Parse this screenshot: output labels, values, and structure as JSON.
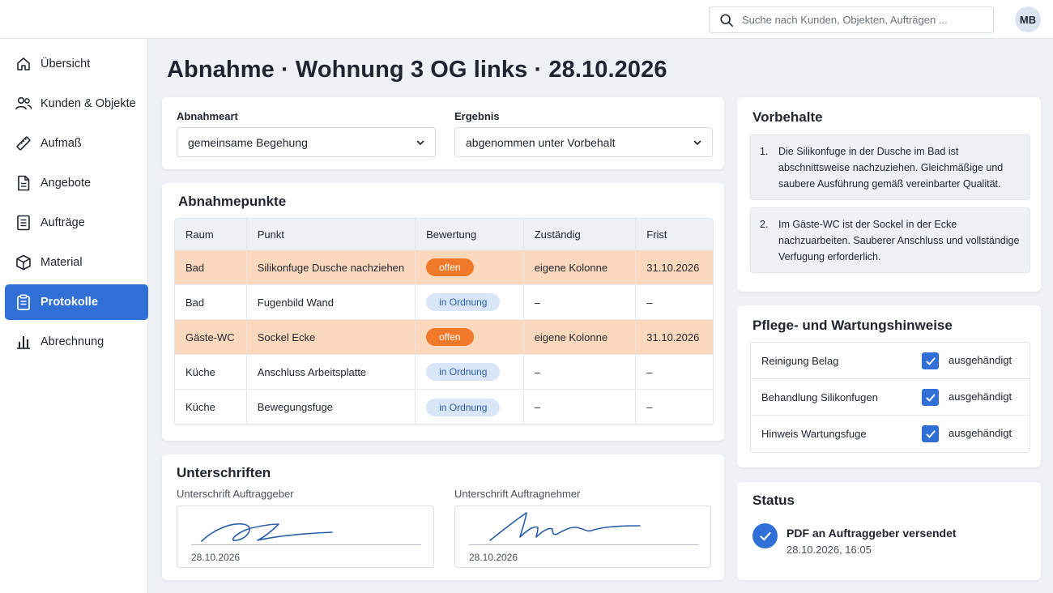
{
  "header": {
    "search_placeholder": "Suche nach Kunden, Objekten, Aufträgen ...",
    "avatar_initials": "MB"
  },
  "sidebar": {
    "items": [
      {
        "label": "Übersicht",
        "icon": "home-icon"
      },
      {
        "label": "Kunden & Objekte",
        "icon": "users-icon"
      },
      {
        "label": "Aufmaß",
        "icon": "ruler-icon"
      },
      {
        "label": "Angebote",
        "icon": "document-icon"
      },
      {
        "label": "Aufträge",
        "icon": "list-icon"
      },
      {
        "label": "Material",
        "icon": "box-icon"
      },
      {
        "label": "Protokolle",
        "icon": "clipboard-icon",
        "active": true
      },
      {
        "label": "Abrechnung",
        "icon": "bar-chart-icon"
      }
    ]
  },
  "page": {
    "title": "Abnahme · Wohnung 3 OG links · 28.10.2026"
  },
  "form": {
    "abnahmeart_label": "Abnahmeart",
    "abnahmeart_value": "gemeinsame Begehung",
    "ergebnis_label": "Ergebnis",
    "ergebnis_value": "abgenommen unter Vorbehalt"
  },
  "abnahmepunkte": {
    "title": "Abnahmepunkte",
    "columns": [
      "Raum",
      "Punkt",
      "Bewertung",
      "Zuständig",
      "Frist"
    ],
    "rows": [
      {
        "raum": "Bad",
        "punkt": "Silikonfuge Dusche nachziehen",
        "bewertung": "offen",
        "zustaendig": "eigene Kolonne",
        "frist": "31.10.2026"
      },
      {
        "raum": "Bad",
        "punkt": "Fugenbild Wand",
        "bewertung": "in Ordnung",
        "zustaendig": "–",
        "frist": "–"
      },
      {
        "raum": "Gäste-WC",
        "punkt": "Sockel Ecke",
        "bewertung": "offen",
        "zustaendig": "eigene Kolonne",
        "frist": "31.10.2026"
      },
      {
        "raum": "Küche",
        "punkt": "Anschluss Arbeitsplatte",
        "bewertung": "in Ordnung",
        "zustaendig": "–",
        "frist": "–"
      },
      {
        "raum": "Küche",
        "punkt": "Bewegungsfuge",
        "bewertung": "in Ordnung",
        "zustaendig": "–",
        "frist": "–"
      }
    ]
  },
  "unterschriften": {
    "title": "Unterschriften",
    "auftraggeber_label": "Unterschrift Auftraggeber",
    "auftraggeber_date": "28.10.2026",
    "auftragnehmer_label": "Unterschrift Auftragnehmer",
    "auftragnehmer_date": "28.10.2026"
  },
  "vorbehalte": {
    "title": "Vorbehalte",
    "items": [
      {
        "num": "1.",
        "text": "Die Silikonfuge in der Dusche im Bad ist abschnittsweise nachzuziehen. Gleichmäßige und saubere Ausführung gemäß vereinbarter Qualität."
      },
      {
        "num": "2.",
        "text": "Im Gäste-WC ist der Sockel in der Ecke nachzuarbeiten. Sauberer Anschluss und vollständige Verfugung erforderlich."
      }
    ]
  },
  "pflege": {
    "title": "Pflege- und Wartungshinweise",
    "items": [
      {
        "label": "Reinigung Belag",
        "state": "ausgehändigt",
        "checked": true
      },
      {
        "label": "Behandlung Silikonfugen",
        "state": "ausgehändigt",
        "checked": true
      },
      {
        "label": "Hinweis Wartungsfuge",
        "state": "ausgehändigt",
        "checked": true
      }
    ]
  },
  "status": {
    "title": "Status",
    "text": "PDF an Auftraggeber versendet",
    "time": "28.10.2026, 16:05"
  },
  "colors": {
    "accent": "#2f6fd6",
    "open_row": "#fcd9bd",
    "open_badge": "#f07a2a",
    "ok_badge": "#d9e6f7"
  }
}
